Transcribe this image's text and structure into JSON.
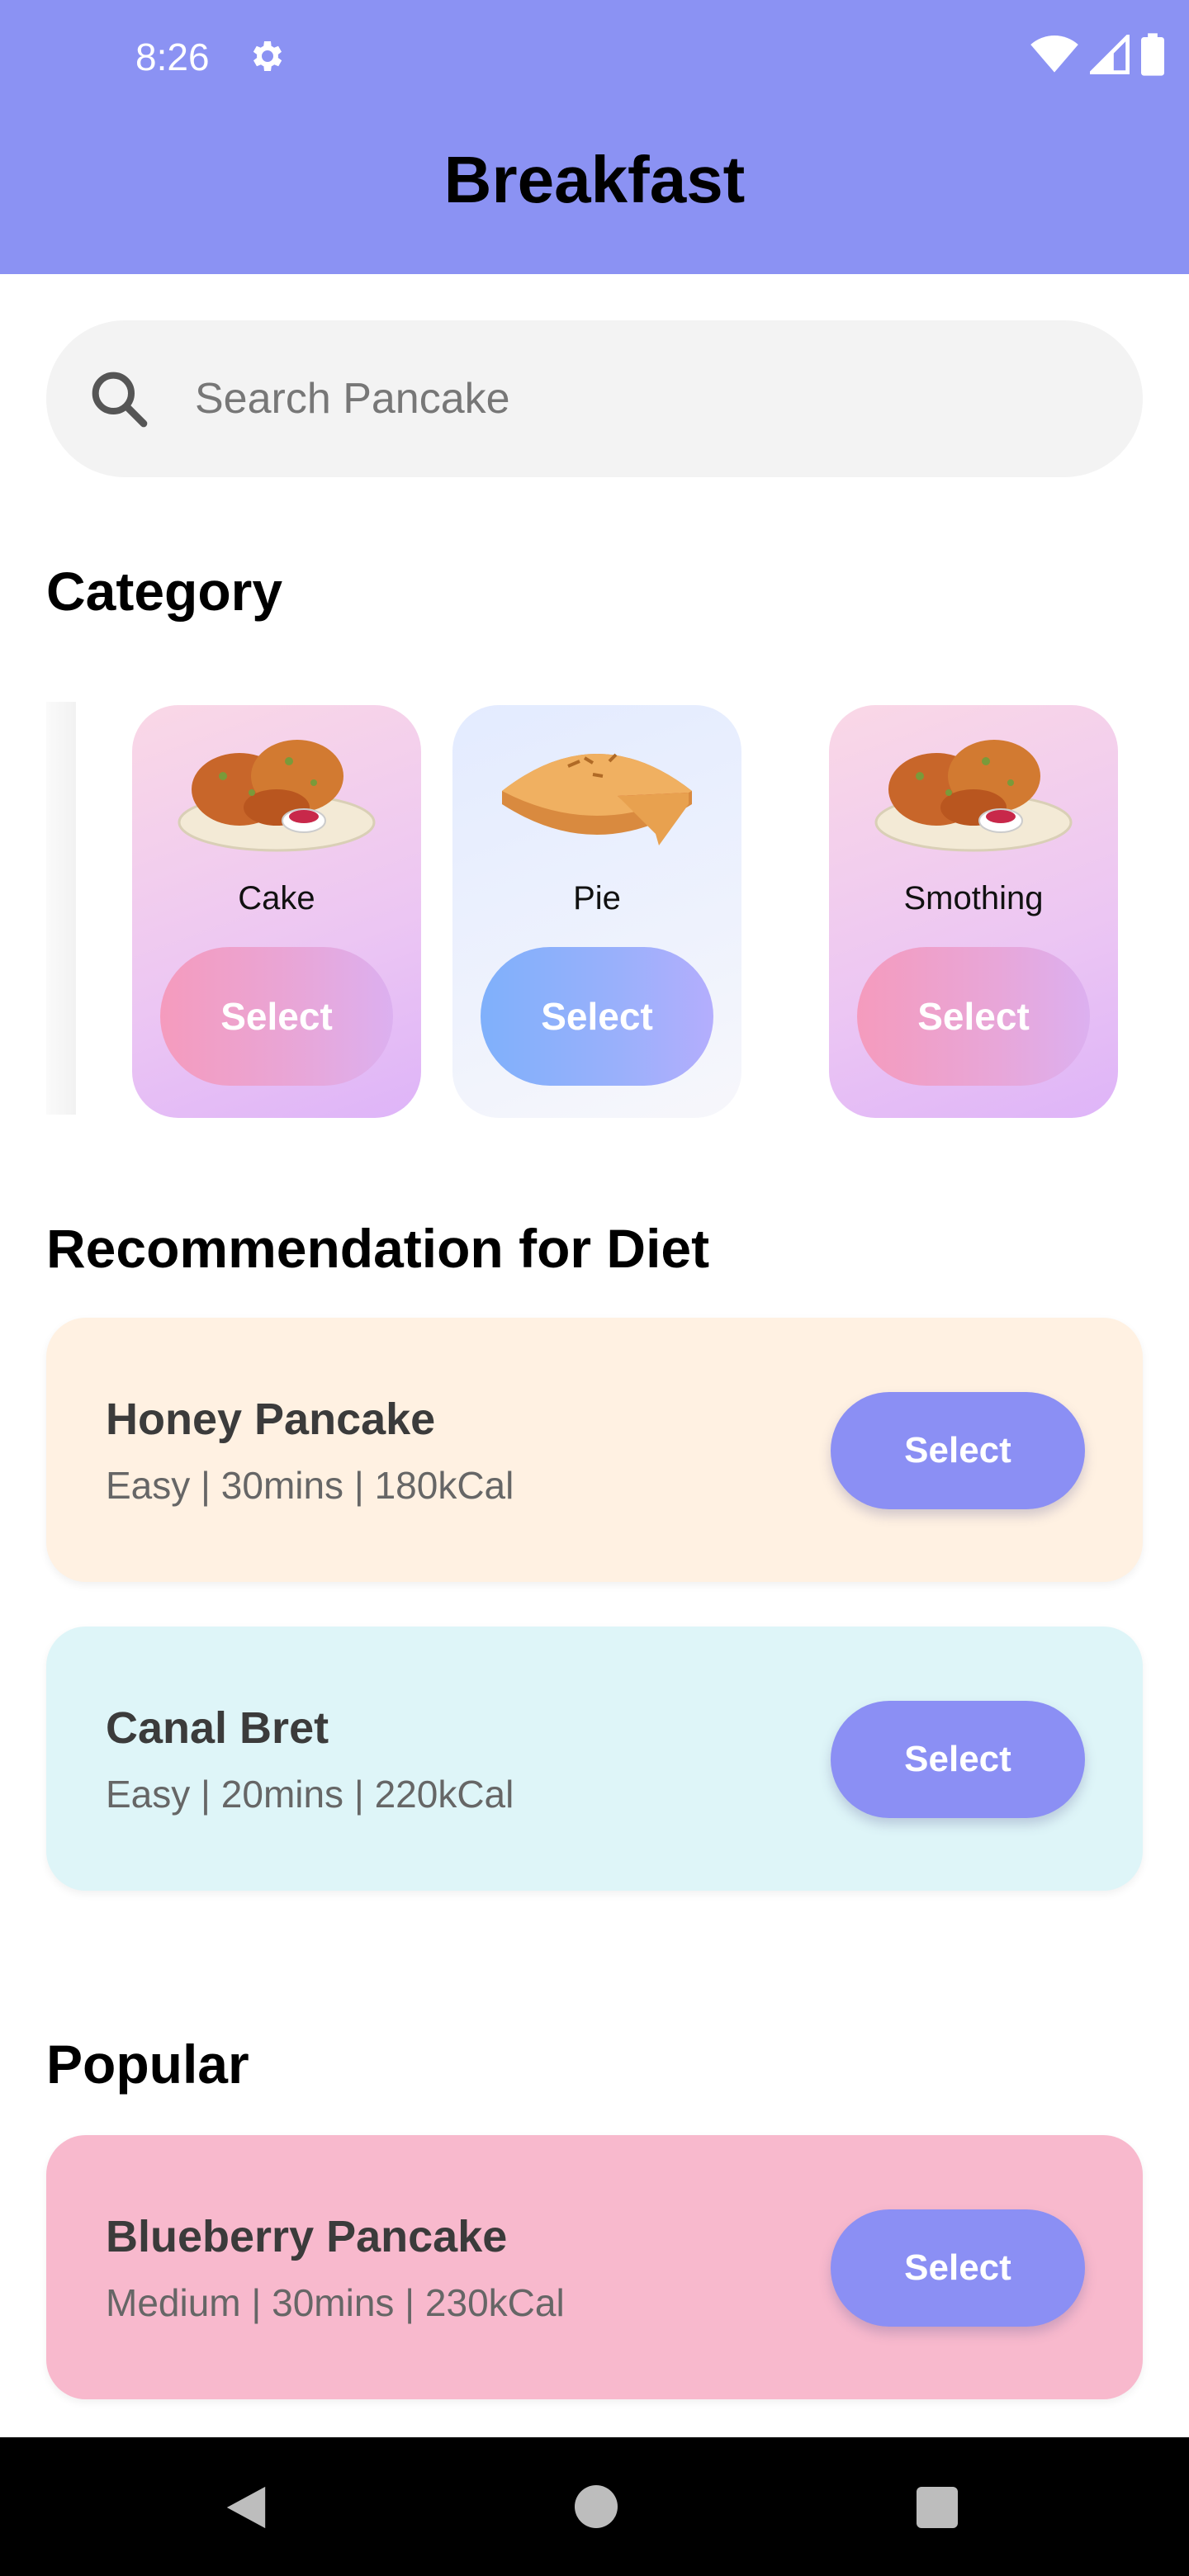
{
  "status_bar": {
    "time": "8:26"
  },
  "app_bar": {
    "title": "Breakfast"
  },
  "search": {
    "placeholder": "Search Pancake"
  },
  "category": {
    "title": "Category",
    "items": [
      {
        "label": "Cake",
        "button": "Select",
        "image": "chicken-plate-icon",
        "style": "pink"
      },
      {
        "label": "Pie",
        "button": "Select",
        "image": "pie-icon",
        "style": "blue"
      },
      {
        "label": "Smothing",
        "button": "Select",
        "image": "chicken-plate-icon",
        "style": "pink"
      }
    ]
  },
  "recommendation": {
    "title": "Recommendation for Diet",
    "items": [
      {
        "name": "Honey Pancake",
        "info": "Easy | 30mins | 180kCal",
        "button": "Select",
        "bg": "#fff1e2"
      },
      {
        "name": "Canal Bret",
        "info": "Easy | 20mins | 220kCal",
        "button": "Select",
        "bg": "#def5f8"
      }
    ]
  },
  "popular": {
    "title": "Popular",
    "items": [
      {
        "name": "Blueberry Pancake",
        "info": "Medium | 30mins | 230kCal",
        "button": "Select",
        "bg": "#f8b9cd"
      }
    ]
  },
  "colors": {
    "accent": "#8b92f3",
    "button": "#8b8ff4"
  }
}
